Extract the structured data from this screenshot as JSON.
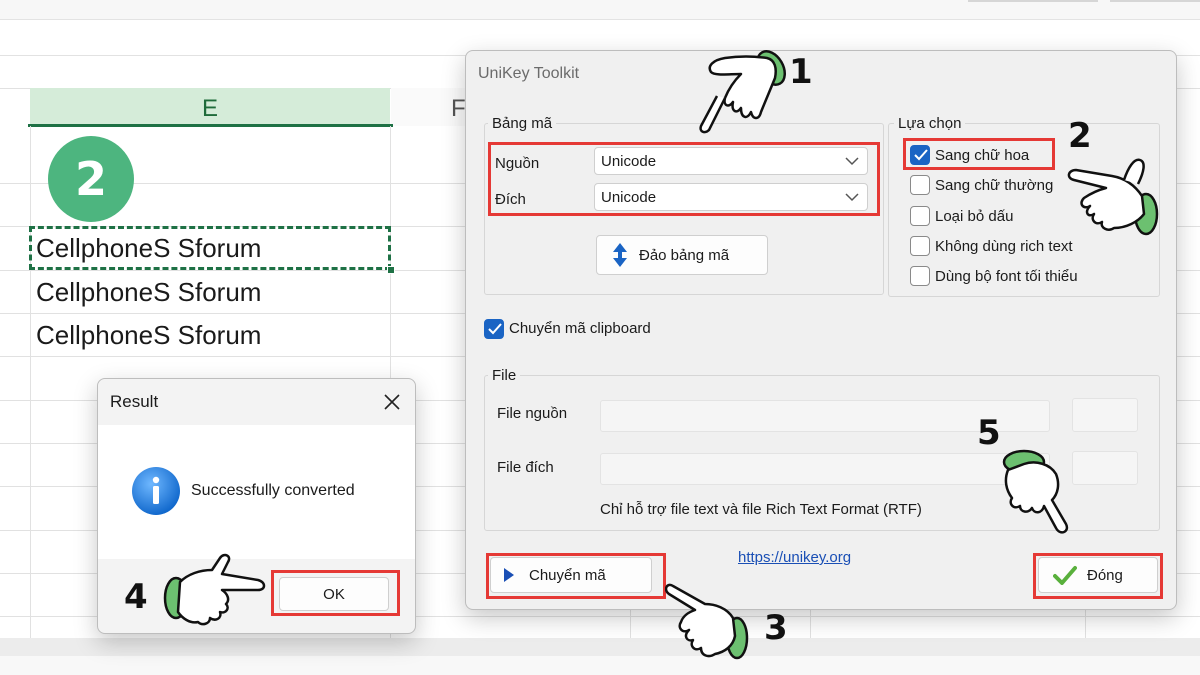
{
  "sheet": {
    "column_e": "E",
    "column_f": "F",
    "cells": [
      "CellphoneS Sforum",
      "CellphoneS Sforum",
      "CellphoneS Sforum"
    ]
  },
  "steps": {
    "badge_sheet": "2",
    "step1": "1",
    "step2": "2",
    "step3": "3",
    "step4": "4",
    "step5": "5"
  },
  "result_dialog": {
    "title": "Result",
    "message": "Successfully converted",
    "ok_label": "OK",
    "icon": "info-icon"
  },
  "toolkit": {
    "title": "UniKey Toolkit",
    "charset_group": "Bảng mã",
    "source_label": "Nguồn",
    "source_value": "Unicode",
    "target_label": "Đích",
    "target_value": "Unicode",
    "swap_label": "Đảo bảng mã",
    "options_group": "Lựa chọn",
    "options": [
      {
        "label": "Sang chữ hoa",
        "checked": true
      },
      {
        "label": "Sang chữ thường",
        "checked": false
      },
      {
        "label": "Loại bỏ dấu",
        "checked": false
      },
      {
        "label": "Không dùng rich text",
        "checked": false
      },
      {
        "label": "Dùng bộ font tối thiểu",
        "checked": false
      }
    ],
    "clipboard_label": "Chuyển mã clipboard",
    "clipboard_checked": true,
    "file_group": "File",
    "file_source_label": "File nguồn",
    "file_target_label": "File đích",
    "file_note": "Chỉ hỗ trợ file text và file Rich Text Format (RTF)",
    "link": "https://unikey.org",
    "convert_label": "Chuyển mã",
    "close_label": "Đóng"
  },
  "colors": {
    "highlight": "#e53935",
    "accent": "#1a64c4",
    "excel_green": "#1e7145",
    "badge_green": "#4db57f"
  }
}
